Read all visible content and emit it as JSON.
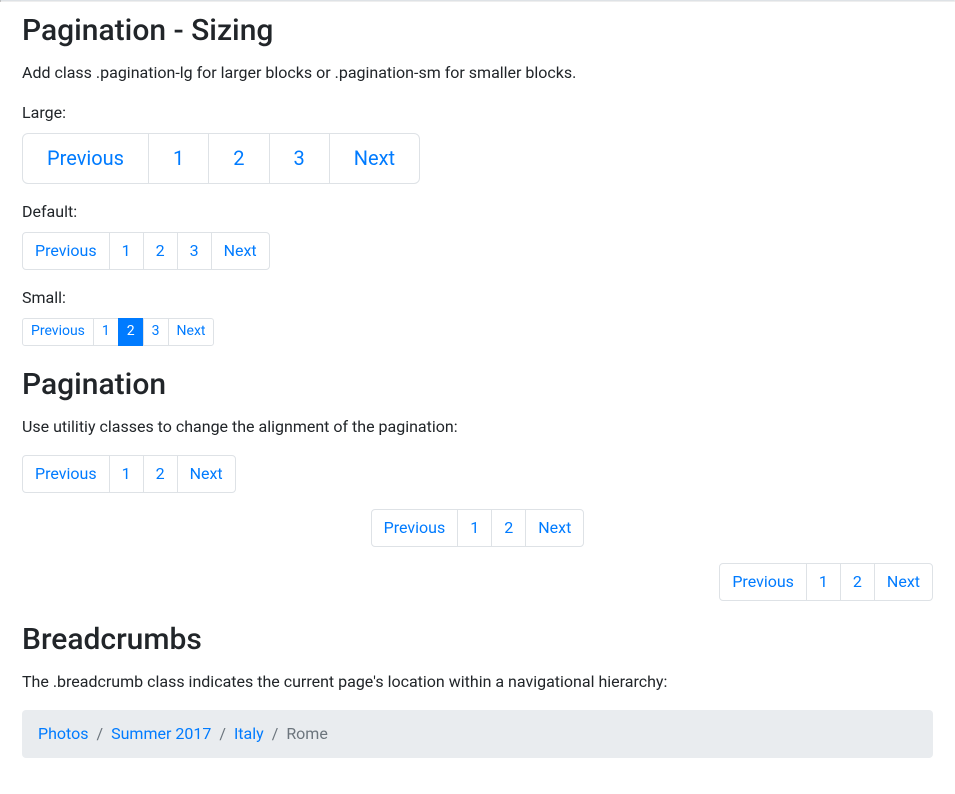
{
  "sizing": {
    "heading": "Pagination - Sizing",
    "desc": "Add class .pagination-lg for larger blocks or .pagination-sm for smaller blocks.",
    "large_label": "Large:",
    "large_items": [
      "Previous",
      "1",
      "2",
      "3",
      "Next"
    ],
    "default_label": "Default:",
    "default_items": [
      "Previous",
      "1",
      "2",
      "3",
      "Next"
    ],
    "small_label": "Small:",
    "small_items": [
      "Previous",
      "1",
      "2",
      "3",
      "Next"
    ],
    "small_active_index": 2
  },
  "alignment": {
    "heading": "Pagination",
    "desc": "Use utilitiy classes to change the alignment of the pagination:",
    "items": [
      "Previous",
      "1",
      "2",
      "Next"
    ]
  },
  "breadcrumb": {
    "heading": "Breadcrumbs",
    "desc": "The .breadcrumb class indicates the current page's location within a navigational hierarchy:",
    "items": [
      "Photos",
      "Summer 2017",
      "Italy",
      "Rome"
    ]
  }
}
